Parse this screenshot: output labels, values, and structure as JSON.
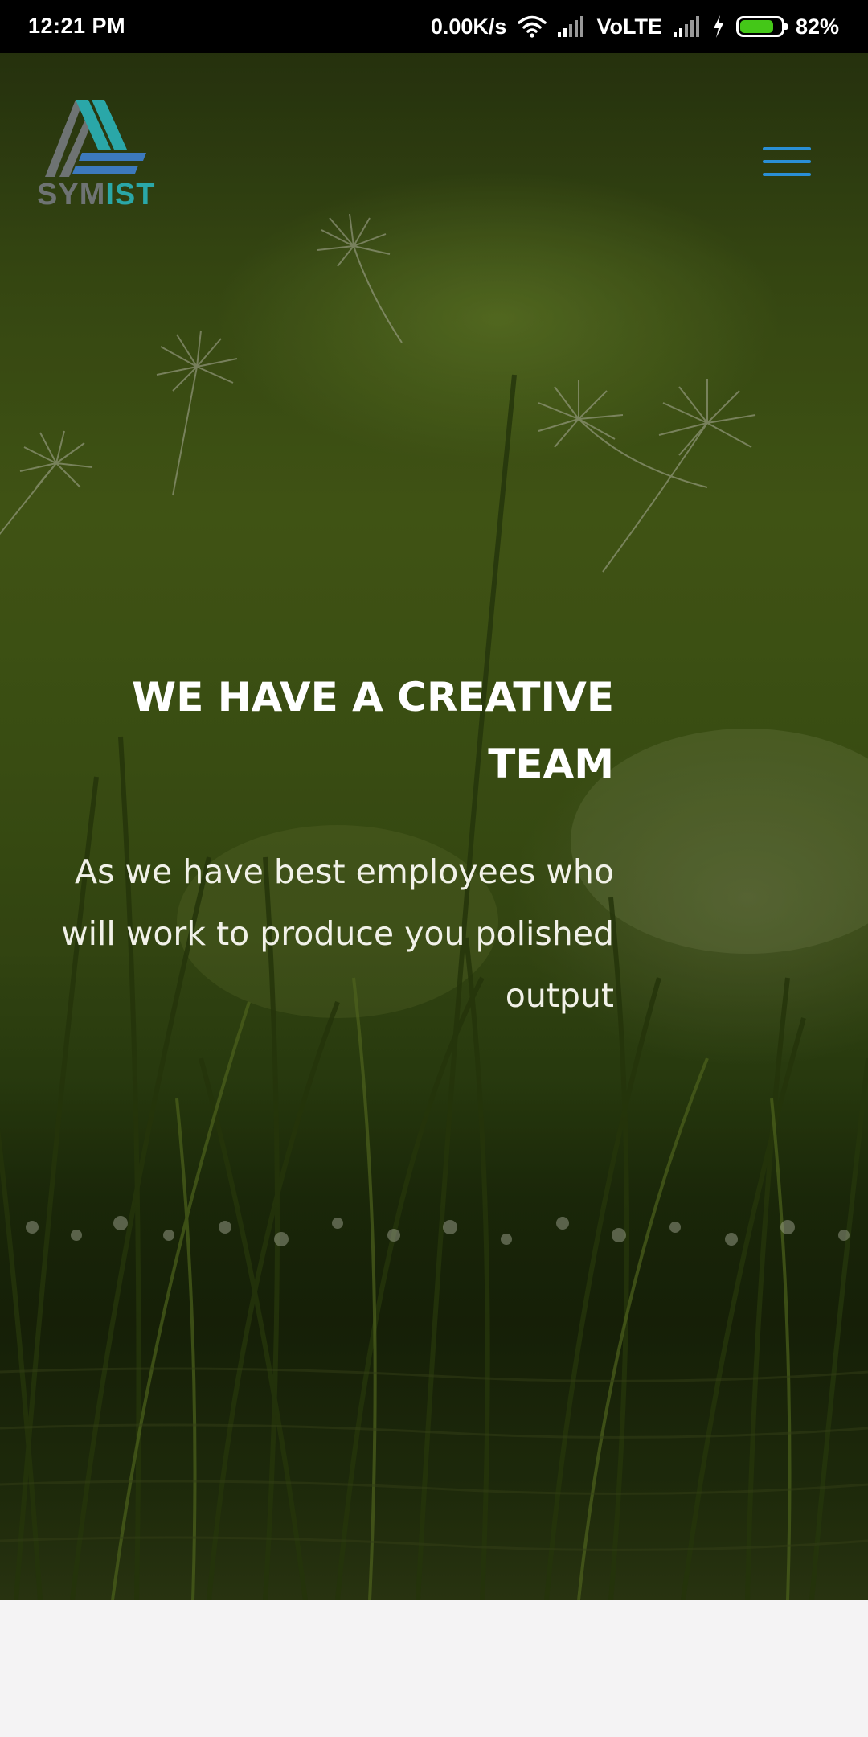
{
  "status_bar": {
    "time": "12:21 PM",
    "net_speed": "0.00K/s",
    "network_label": "VoLTE",
    "battery_percent": "82%",
    "battery_level": 0.82,
    "icons": [
      "wifi-icon",
      "signal-icon",
      "signal-icon",
      "charging-bolt-icon",
      "battery-icon"
    ]
  },
  "header": {
    "logo": {
      "wordmark_part1": "SYM",
      "wordmark_part2": "IST",
      "colors": {
        "grey": "#6e7373",
        "teal": "#2aa7a8",
        "blue": "#3c79bd"
      }
    },
    "menu_icon": "hamburger-menu-icon",
    "menu_color": "#2a8fd6"
  },
  "hero": {
    "title": "WE HAVE A CREATIVE TEAM",
    "text": "As we have best employees who will work to produce you polished output"
  },
  "colors": {
    "statusbar_bg": "#000000",
    "battery_fill": "#44c718",
    "page_bg": "#f4f3f4"
  }
}
